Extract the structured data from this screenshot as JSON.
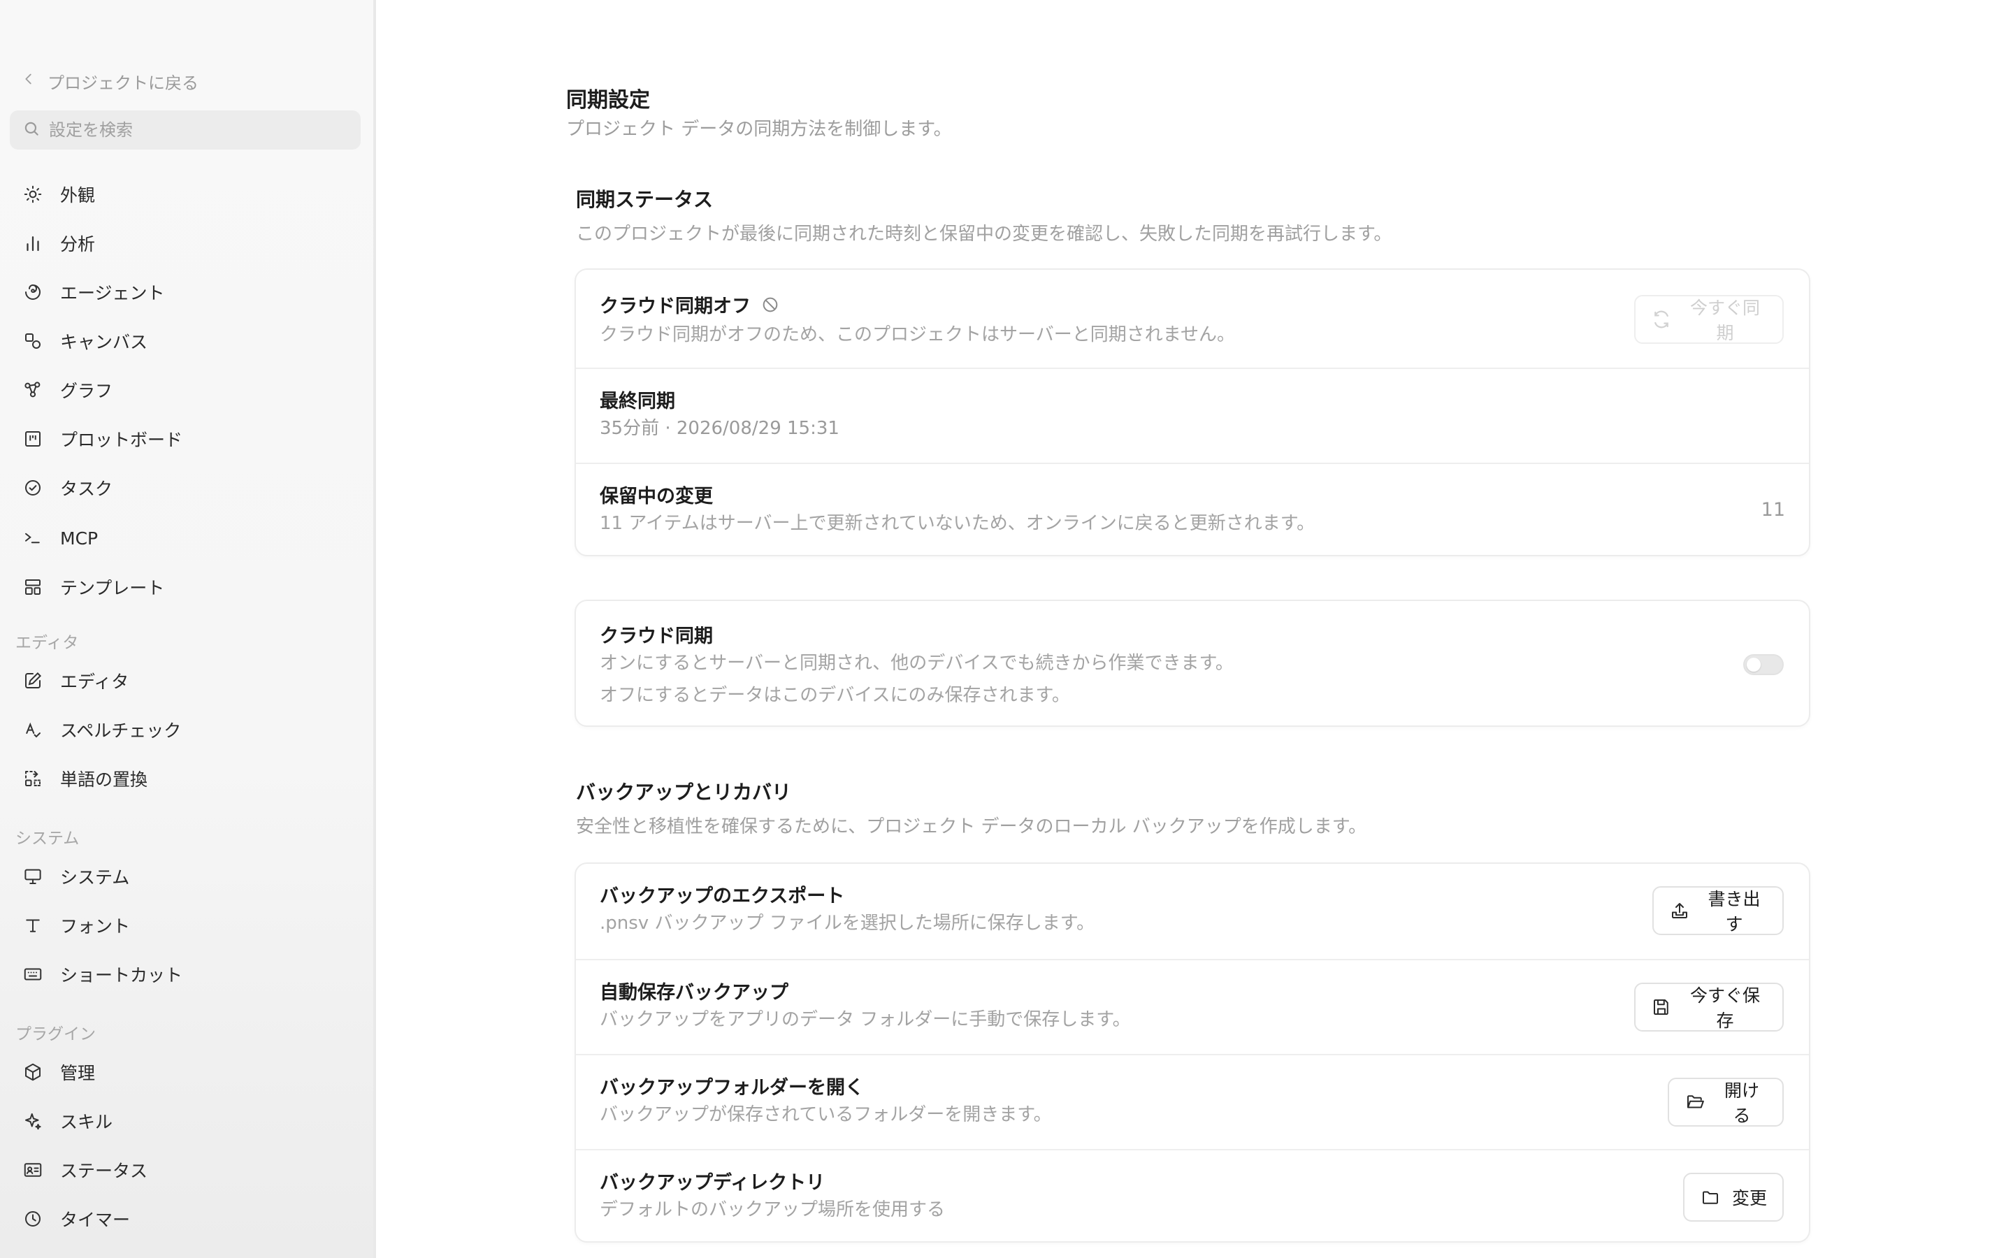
{
  "sidebar": {
    "back_label": "プロジェクトに戻る",
    "search_placeholder": "設定を検索",
    "items_main": [
      {
        "label": "外観",
        "icon": "sun-icon"
      },
      {
        "label": "分析",
        "icon": "bar-chart-icon"
      },
      {
        "label": "エージェント",
        "icon": "spiral-icon"
      },
      {
        "label": "キャンバス",
        "icon": "shapes-icon"
      },
      {
        "label": "グラフ",
        "icon": "graph-nodes-icon"
      },
      {
        "label": "プロットボード",
        "icon": "kanban-icon"
      },
      {
        "label": "タスク",
        "icon": "check-circle-icon"
      },
      {
        "label": "MCP",
        "icon": "terminal-icon"
      },
      {
        "label": "テンプレート",
        "icon": "layout-template-icon"
      }
    ],
    "section_editor": "エディタ",
    "items_editor": [
      {
        "label": "エディタ",
        "icon": "pencil-square-icon"
      },
      {
        "label": "スペルチェック",
        "icon": "spell-check-icon"
      },
      {
        "label": "単語の置換",
        "icon": "replace-icon"
      }
    ],
    "section_system": "システム",
    "items_system": [
      {
        "label": "システム",
        "icon": "monitor-icon"
      },
      {
        "label": "フォント",
        "icon": "type-icon"
      },
      {
        "label": "ショートカット",
        "icon": "keyboard-icon"
      }
    ],
    "section_plugins": "プラグイン",
    "items_plugins": [
      {
        "label": "管理",
        "icon": "box-icon"
      },
      {
        "label": "スキル",
        "icon": "sparkle-icon"
      },
      {
        "label": "ステータス",
        "icon": "id-card-icon"
      },
      {
        "label": "タイマー",
        "icon": "clock-icon"
      }
    ]
  },
  "main": {
    "title": "同期設定",
    "subtitle": "プロジェクト データの同期方法を制御します。",
    "status_section": {
      "title": "同期ステータス",
      "subtitle": "このプロジェクトが最後に同期された時刻と保留中の変更を確認し、失敗した同期を再試行します。",
      "cloud_off_title": "クラウド同期オフ",
      "cloud_off_desc": "クラウド同期がオフのため、このプロジェクトはサーバーと同期されません。",
      "sync_now_label": "今すぐ同期",
      "last_sync_title": "最終同期",
      "last_sync_value": "35分前 · 2026/08/29 15:31",
      "pending_title": "保留中の変更",
      "pending_desc": "11 アイテムはサーバー上で更新されていないため、オンラインに戻ると更新されます。",
      "pending_count": "11"
    },
    "cloud_sync": {
      "title": "クラウド同期",
      "desc_line1": "オンにするとサーバーと同期され、他のデバイスでも続きから作業できます。",
      "desc_line2": "オフにするとデータはこのデバイスにのみ保存されます。",
      "enabled": false
    },
    "backup_section": {
      "title": "バックアップとリカバリ",
      "subtitle": "安全性と移植性を確保するために、プロジェクト データのローカル バックアップを作成します。",
      "export_title": "バックアップのエクスポート",
      "export_desc": ".pnsv バックアップ ファイルを選択した場所に保存します。",
      "export_button": "書き出す",
      "autosave_title": "自動保存バックアップ",
      "autosave_desc": "バックアップをアプリのデータ フォルダーに手動で保存します。",
      "autosave_button": "今すぐ保存",
      "open_folder_title": "バックアップフォルダーを開く",
      "open_folder_desc": "バックアップが保存されているフォルダーを開きます。",
      "open_folder_button": "開ける",
      "directory_title": "バックアップディレクトリ",
      "directory_desc": "デフォルトのバックアップ場所を使用する",
      "directory_button": "変更"
    }
  }
}
